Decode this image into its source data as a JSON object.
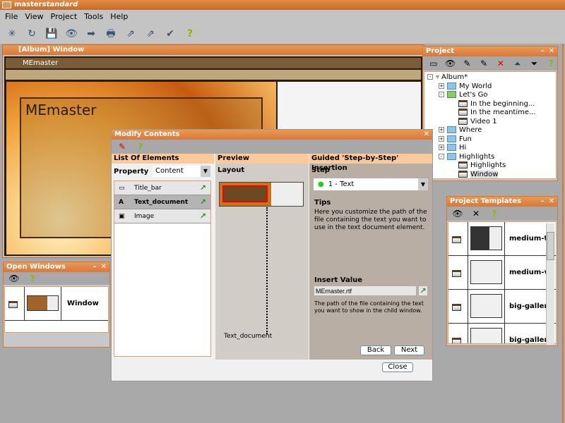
{
  "app": {
    "title_bold": "master",
    "title_italic": "standard"
  },
  "menu": [
    "File",
    "View",
    "Project",
    "Tools",
    "Help"
  ],
  "toolbar": [
    "new-project-icon",
    "open-project-icon",
    "save-icon",
    "preview-icon",
    "export-icon",
    "print-icon",
    "publish-icon",
    "publish-all-icon",
    "validate-icon",
    "help-icon"
  ],
  "album_window": {
    "title": "[Album] Window",
    "bar_title": "MEmaster",
    "content_title": "MEmaster"
  },
  "open_windows": {
    "title": "Open Windows",
    "items": [
      {
        "name": "Window"
      }
    ]
  },
  "project": {
    "title": "Project",
    "tree": [
      {
        "label": "Album*",
        "level": 0,
        "type": "album",
        "expander": "-"
      },
      {
        "label": "My World",
        "level": 1,
        "type": "folder",
        "expander": "+"
      },
      {
        "label": "Let's Go",
        "level": 1,
        "type": "folder-open",
        "expander": "-"
      },
      {
        "label": "In the beginning...",
        "level": 2,
        "type": "window"
      },
      {
        "label": "In the meantime...",
        "level": 2,
        "type": "window"
      },
      {
        "label": "Video 1",
        "level": 2,
        "type": "window"
      },
      {
        "label": "Where",
        "level": 1,
        "type": "folder",
        "expander": "+"
      },
      {
        "label": "Fun",
        "level": 1,
        "type": "folder",
        "expander": "+"
      },
      {
        "label": "Hi",
        "level": 1,
        "type": "folder",
        "expander": "+"
      },
      {
        "label": "Highlights",
        "level": 1,
        "type": "folder",
        "expander": "-"
      },
      {
        "label": "Highlights",
        "level": 2,
        "type": "window"
      },
      {
        "label": "Window",
        "level": 2,
        "type": "window",
        "selected": true
      }
    ]
  },
  "templates": {
    "title": "Project Templates",
    "items": [
      "medium-te",
      "medium-vid",
      "big-gallery_",
      "big-gallery_"
    ]
  },
  "dialog": {
    "title": "Modify Contents",
    "list": {
      "header": "List Of Elements",
      "property_label": "Property",
      "property_value": "Content",
      "items": [
        {
          "label": "Title_bar",
          "selected": false
        },
        {
          "label": "Text_document",
          "selected": true
        },
        {
          "label": "Image",
          "selected": false
        }
      ]
    },
    "preview": {
      "header": "Preview",
      "layout_label": "Layout",
      "element_label": "Text_document"
    },
    "guided": {
      "header": "Guided 'Step-by-Step' Insertion",
      "step_label": "Step",
      "step_value": "1  - Text",
      "tips_label": "Tips",
      "tips_text": "Here you customize the path of the file containing the text you want to use in the text document element.",
      "insert_label": "Insert Value",
      "insert_value": "MEmaster.rtf",
      "insert_help": "The path of the file containing the text you want to show in the child window.",
      "back": "Back",
      "next": "Next"
    },
    "close": "Close"
  },
  "colors": {
    "accent": "#d9773a",
    "header": "#fbc99a",
    "panel": "#b8aea4"
  }
}
